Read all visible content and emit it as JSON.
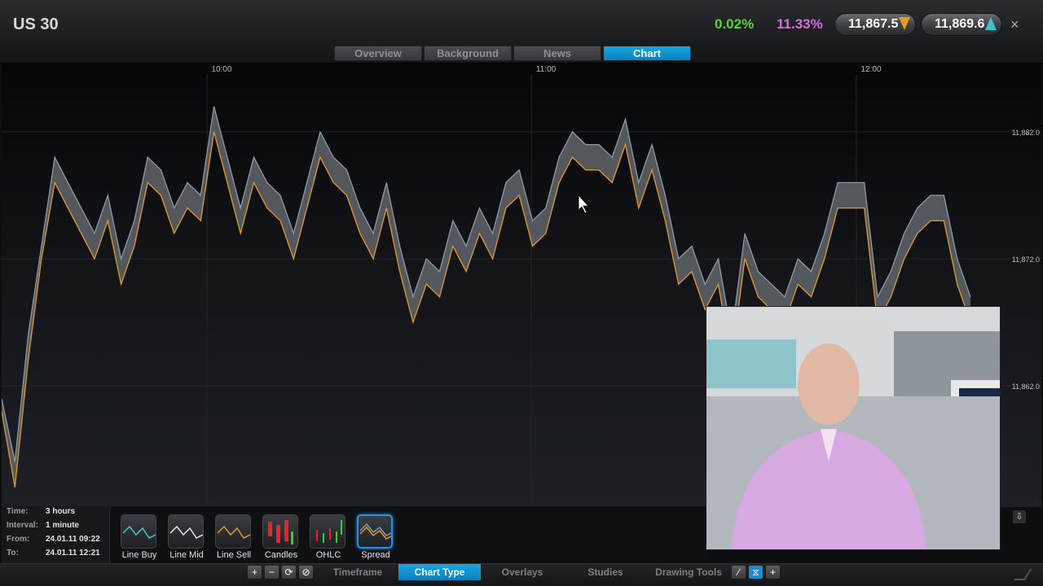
{
  "header": {
    "title": "US 30",
    "change_pct": "0.02%",
    "change_pct_color": "#5fd336",
    "second_pct": "11.33%",
    "second_pct_color": "#d76ed9",
    "sell_price": "11,867.5",
    "buy_price": "11,869.6",
    "close_symbol": "×"
  },
  "tabs": [
    "Overview",
    "Background",
    "News",
    "Chart"
  ],
  "active_tab": "Chart",
  "chart_data": {
    "type": "area",
    "x_ticks": [
      "10:00",
      "11:00",
      "12:00"
    ],
    "y_ticks": [
      "11,882.0",
      "11,872.0",
      "11,862.0"
    ],
    "ylim": [
      11856,
      11886
    ],
    "series": [
      {
        "name": "Buy",
        "color": "#8d9aa3",
        "values": [
          11861,
          11856,
          11866,
          11873,
          11880,
          11878,
          11876,
          11874,
          11877,
          11872,
          11875,
          11880,
          11879,
          11876,
          11878,
          11877,
          11884,
          11880,
          11876,
          11880,
          11878,
          11877,
          11874,
          11878,
          11882,
          11880,
          11879,
          11876,
          11874,
          11878,
          11873,
          11869,
          11872,
          11871,
          11875,
          11873,
          11876,
          11874,
          11878,
          11879,
          11875,
          11876,
          11880,
          11882,
          11881,
          11881,
          11880,
          11883,
          11878,
          11881,
          11877,
          11872,
          11873,
          11870,
          11872,
          11866,
          11874,
          11871,
          11870,
          11869,
          11872,
          11871,
          11874,
          11878,
          11878,
          11878,
          11869,
          11871,
          11874,
          11876,
          11877,
          11877,
          11872,
          11869
        ]
      },
      {
        "name": "Sell",
        "color": "#e09a2a",
        "values": [
          11860,
          11854,
          11864,
          11872,
          11878,
          11876,
          11874,
          11872,
          11875,
          11870,
          11873,
          11878,
          11877,
          11874,
          11876,
          11875,
          11882,
          11878,
          11874,
          11878,
          11876,
          11875,
          11872,
          11876,
          11880,
          11878,
          11877,
          11874,
          11872,
          11876,
          11871,
          11867,
          11870,
          11869,
          11873,
          11871,
          11874,
          11872,
          11876,
          11877,
          11873,
          11874,
          11878,
          11880,
          11879,
          11879,
          11878,
          11881,
          11876,
          11879,
          11875,
          11870,
          11871,
          11868,
          11870,
          11864,
          11872,
          11869,
          11868,
          11867,
          11870,
          11869,
          11872,
          11876,
          11876,
          11876,
          11867,
          11869,
          11872,
          11874,
          11875,
          11875,
          11870,
          11867
        ]
      }
    ],
    "grid": true
  },
  "info": [
    {
      "key": "Time:",
      "value": "3 hours"
    },
    {
      "key": "Interval:",
      "value": "1 minute"
    },
    {
      "key": "From:",
      "value": "24.01.11 09:22"
    },
    {
      "key": "To:",
      "value": "24.01.11 12:21"
    }
  ],
  "chart_types": [
    {
      "label": "Line Buy",
      "icon": "line-buy-icon",
      "active": false
    },
    {
      "label": "Line Mid",
      "icon": "line-mid-icon",
      "active": false
    },
    {
      "label": "Line Sell",
      "icon": "line-sell-icon",
      "active": false
    },
    {
      "label": "Candles",
      "icon": "candles-icon",
      "active": false
    },
    {
      "label": "OHLC",
      "icon": "ohlc-icon",
      "active": false
    },
    {
      "label": "Spread",
      "icon": "spread-icon",
      "active": true
    }
  ],
  "bottom_tabs": [
    "Timeframe",
    "Chart Type",
    "Overlays",
    "Studies",
    "Drawing Tools"
  ],
  "active_bottom_tab": "Chart Type",
  "tools": [
    "+",
    "−",
    "⟳",
    "⊘"
  ],
  "colors": {
    "accent": "#1aa6e0",
    "buy_line": "#8d9aa3",
    "sell_line": "#e09a2a"
  }
}
